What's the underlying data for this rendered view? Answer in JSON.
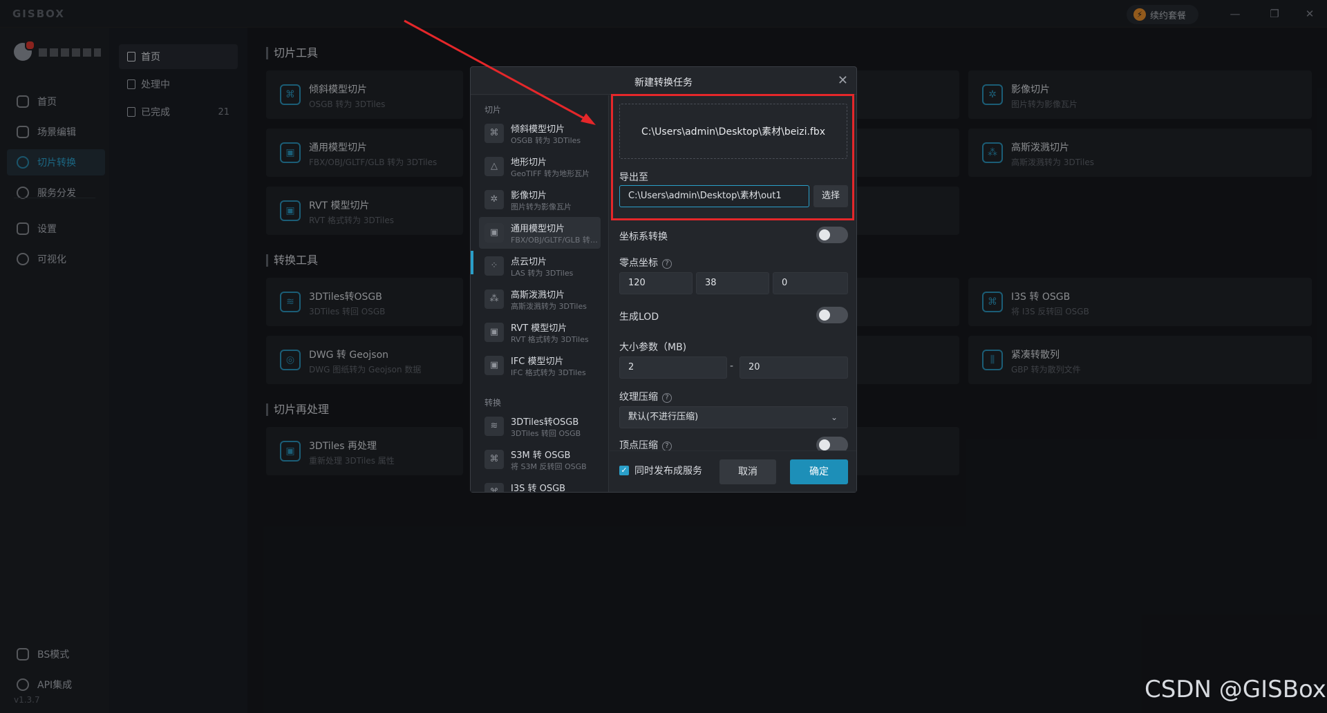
{
  "app": {
    "logo": "GISBOX",
    "renew_label": "续约套餐",
    "version": "v1.3.7"
  },
  "window_controls": {
    "minimize": "—",
    "restore": "❐",
    "close": "✕"
  },
  "sidebar": {
    "items": [
      {
        "label": "首页",
        "icon": "home-icon"
      },
      {
        "label": "场景编辑",
        "icon": "scene-edit-icon"
      },
      {
        "label": "切片转换",
        "icon": "convert-icon",
        "active": true
      },
      {
        "label": "服务分发",
        "icon": "service-icon"
      },
      {
        "label": "设置",
        "icon": "gear-icon"
      },
      {
        "label": "可视化",
        "icon": "visual-icon"
      }
    ],
    "bottom": [
      {
        "label": "BS模式",
        "icon": "code-icon"
      },
      {
        "label": "API集成",
        "icon": "link-icon"
      }
    ]
  },
  "subnav": {
    "items": [
      {
        "label": "首页"
      },
      {
        "label": "处理中"
      },
      {
        "label": "已完成",
        "count": "21"
      }
    ]
  },
  "sections": {
    "slice_tools": "切片工具",
    "convert_tools": "转换工具",
    "reprocess": "切片再处理"
  },
  "cards": {
    "c1": {
      "name": "倾斜模型切片",
      "desc": "OSGB 转为 3DTiles"
    },
    "c2": {
      "name": "通用模型切片",
      "desc": "FBX/OBJ/GLTF/GLB 转为 3DTiles"
    },
    "c3": {
      "name": "RVT 模型切片",
      "desc": "RVT 格式转为 3DTiles"
    },
    "c4": {
      "name": "3DTiles转OSGB",
      "desc": "3DTiles 转回 OSGB"
    },
    "c5": {
      "name": "DWG 转 Geojson",
      "desc": "DWG 图纸转为 Geojson 数据"
    },
    "c6": {
      "name": "3DTiles 再处理",
      "desc": "重新处理 3DTiles 属性"
    },
    "r1": {
      "name": "影像切片",
      "desc": "图片转为影像瓦片"
    },
    "r2": {
      "name": "高斯泼溅切片",
      "desc": "高斯泼溅转为 3DTiles"
    },
    "r3": {
      "name": "I3S 转 OSGB",
      "desc": "将 I3S 反转回 OSGB"
    },
    "r4": {
      "name": "紧凑转散列",
      "desc": "GBP 转为散列文件"
    }
  },
  "modal": {
    "title": "新建转换任务",
    "group_slice": "切片",
    "group_convert": "转换",
    "list": [
      {
        "name": "倾斜模型切片",
        "desc": "OSGB 转为 3DTiles"
      },
      {
        "name": "地形切片",
        "desc": "GeoTIFF 转为地形瓦片"
      },
      {
        "name": "影像切片",
        "desc": "图片转为影像瓦片"
      },
      {
        "name": "通用模型切片",
        "desc": "FBX/OBJ/GLTF/GLB 转为 3DTiles"
      },
      {
        "name": "点云切片",
        "desc": "LAS 转为 3DTiles"
      },
      {
        "name": "高斯泼溅切片",
        "desc": "高斯泼溅转为 3DTiles"
      },
      {
        "name": "RVT 模型切片",
        "desc": "RVT 格式转为 3DTiles"
      },
      {
        "name": "IFC 模型切片",
        "desc": "IFC 格式转为 3DTiles"
      },
      {
        "name": "3DTiles转OSGB",
        "desc": "3DTiles 转回 OSGB"
      },
      {
        "name": "S3M 转 OSGB",
        "desc": "将 S3M 反转回 OSGB"
      },
      {
        "name": "I3S 转 OSGB",
        "desc": ""
      }
    ],
    "file_path": "C:\\Users\\admin\\Desktop\\素材\\beizi.fbx",
    "export_label": "导出至",
    "export_path": "C:\\Users\\admin\\Desktop\\素材\\out1",
    "choose_label": "选择",
    "crs_label": "坐标系转换",
    "origin_label": "零点坐标",
    "origin": {
      "x": "120",
      "y": "38",
      "z": "0"
    },
    "lod_label": "生成LOD",
    "size_label": "大小参数（MB)",
    "size_min": "2",
    "size_max": "20",
    "size_sep": "-",
    "texture_label": "纹理压缩",
    "texture_value": "默认(不进行压缩)",
    "vertex_label": "顶点压缩",
    "publish_label": "同时发布成服务",
    "cancel_label": "取消",
    "ok_label": "确定"
  },
  "watermark": "CSDN @GISBox",
  "colors": {
    "accent": "#1d8fb8",
    "highlight": "#e5272a",
    "background": "#16181d"
  }
}
